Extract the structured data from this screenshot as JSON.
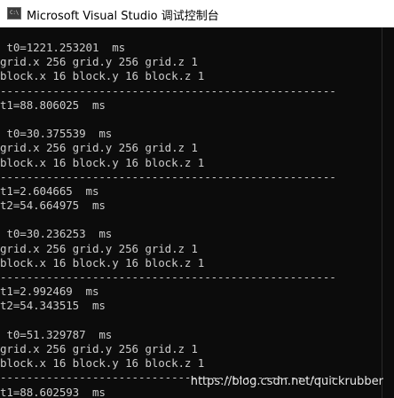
{
  "window": {
    "title": "Microsoft Visual Studio 调试控制台",
    "icon": "console-app-icon",
    "icon_glyph": "C:\\",
    "colors": {
      "console_bg": "#0c0c0c",
      "console_text": "#cccccc",
      "titlebar_bg": "#ffffff"
    }
  },
  "console": {
    "lines": [
      " t0=1221.253201  ms",
      "grid.x 256 grid.y 256 grid.z 1",
      "block.x 16 block.y 16 block.z 1",
      "---------------------------------------------------",
      "t1=88.806025  ms",
      "",
      " t0=30.375539  ms",
      "grid.x 256 grid.y 256 grid.z 1",
      "block.x 16 block.y 16 block.z 1",
      "---------------------------------------------------",
      "t1=2.604665  ms",
      "t2=54.664975  ms",
      "",
      " t0=30.236253  ms",
      "grid.x 256 grid.y 256 grid.z 1",
      "block.x 16 block.y 16 block.z 1",
      "---------------------------------------------------",
      "t1=2.992469  ms",
      "t2=54.343515  ms",
      "",
      " t0=51.329787  ms",
      "grid.x 256 grid.y 256 grid.z 1",
      "block.x 16 block.y 16 block.z 1",
      "---------------------------------------------------",
      "t1=88.602593  ms"
    ]
  },
  "watermark": "https://blog.csdn.net/quickrubber"
}
